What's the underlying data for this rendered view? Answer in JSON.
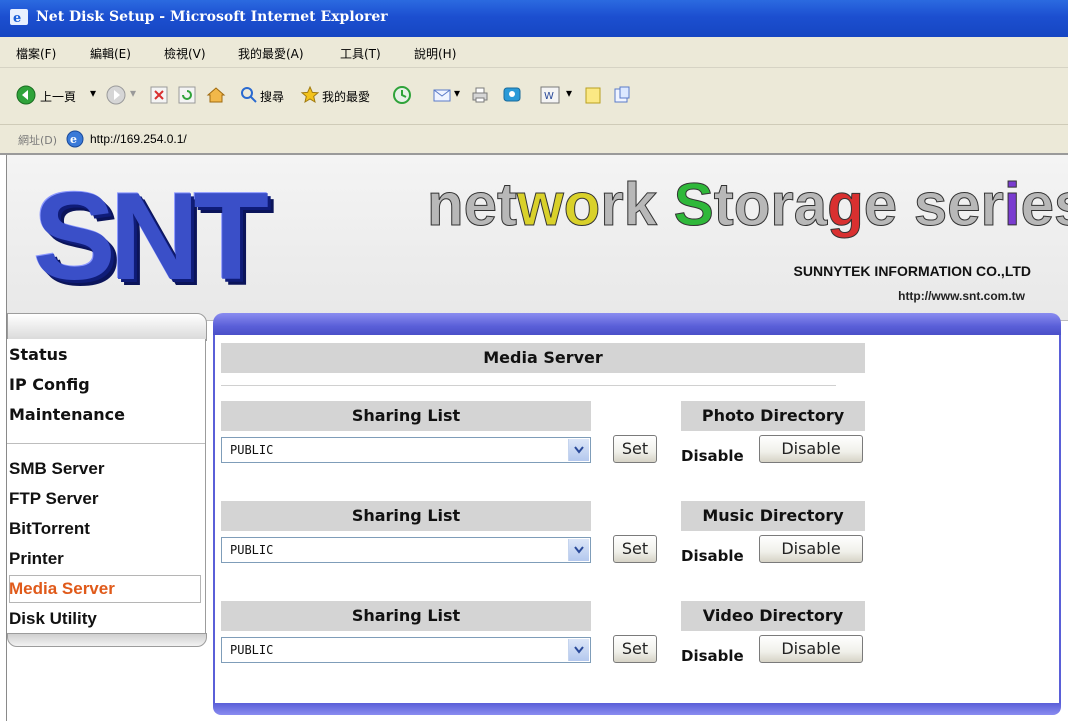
{
  "window": {
    "title": "Net Disk Setup - Microsoft Internet Explorer"
  },
  "menubar": {
    "items": [
      "檔案(F)",
      "編輯(E)",
      "檢視(V)",
      "我的最愛(A)",
      "工具(T)",
      "說明(H)"
    ]
  },
  "toolbar": {
    "back_label": "上一頁",
    "search_label": "搜尋",
    "favorites_label": "我的最愛"
  },
  "address": {
    "label": "網址(D)",
    "url": "http://169.254.0.1/"
  },
  "banner": {
    "logo": "SNT",
    "tagline_parts": [
      "net",
      "wo",
      "rk ",
      "S",
      "tora",
      "g",
      "e ",
      "ser",
      "i",
      "es"
    ],
    "tagline_colors": [
      "#b8b8b8",
      "#d9d12a",
      "#b8b8b8",
      "#2fb83a",
      "#b8b8b8",
      "#d93030",
      "#b8b8b8",
      "#b8b8b8",
      "#7a3cd0",
      "#b8b8b8"
    ],
    "company": "SUNNYTEK INFORMATION CO.,LTD",
    "website": "http://www.snt.com.tw"
  },
  "nav": {
    "items": [
      "Status",
      "IP Config",
      "Maintenance",
      "SMB Server",
      "FTP Server",
      "BitTorrent",
      "Printer",
      "Media Server",
      "Disk Utility"
    ],
    "active": "Media Server",
    "active_color": "#e05a1a"
  },
  "main": {
    "title": "Media Server",
    "rows": [
      {
        "list_header": "Sharing List",
        "select_value": "PUBLIC",
        "set_label": "Set",
        "dir_header": "Photo Directory",
        "status": "Disable",
        "button_label": "Disable"
      },
      {
        "list_header": "Sharing List",
        "select_value": "PUBLIC",
        "set_label": "Set",
        "dir_header": "Music Directory",
        "status": "Disable",
        "button_label": "Disable"
      },
      {
        "list_header": "Sharing List",
        "select_value": "PUBLIC",
        "set_label": "Set",
        "dir_header": "Video Directory",
        "status": "Disable",
        "button_label": "Disable"
      }
    ]
  },
  "colors": {
    "accent": "#5a5fd8",
    "header_bar": "#d4d4d4",
    "titlebar": "#1c4fd0"
  }
}
